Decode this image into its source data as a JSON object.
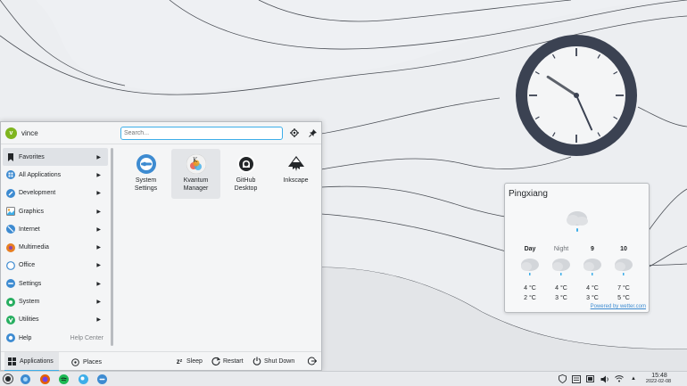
{
  "colors": {
    "accent": "#3daee9",
    "clock_face": "#3b4252",
    "avatar": "#7fb51f"
  },
  "launcher": {
    "user": {
      "initial": "v",
      "name": "vince"
    },
    "search_placeholder": "Search...",
    "categories": [
      {
        "label": "Favorites",
        "icon": "bookmark-icon",
        "extra": ""
      },
      {
        "label": "All Applications",
        "icon": "grid-icon",
        "extra": ""
      },
      {
        "label": "Development",
        "icon": "development-icon",
        "extra": ""
      },
      {
        "label": "Graphics",
        "icon": "graphics-icon",
        "extra": ""
      },
      {
        "label": "Internet",
        "icon": "globe-icon",
        "extra": ""
      },
      {
        "label": "Multimedia",
        "icon": "multimedia-icon",
        "extra": ""
      },
      {
        "label": "Office",
        "icon": "office-icon",
        "extra": ""
      },
      {
        "label": "Settings",
        "icon": "settings-icon",
        "extra": ""
      },
      {
        "label": "System",
        "icon": "system-icon",
        "extra": ""
      },
      {
        "label": "Utilities",
        "icon": "utilities-icon",
        "extra": ""
      },
      {
        "label": "Help",
        "icon": "help-icon",
        "extra": "Help Center"
      }
    ],
    "apps": [
      {
        "line1": "System",
        "line2": "Settings",
        "icon": "system-settings-icon"
      },
      {
        "line1": "Kvantum",
        "line2": "Manager",
        "icon": "kvantum-icon"
      },
      {
        "line1": "GitHub",
        "line2": "Desktop",
        "icon": "github-icon"
      },
      {
        "line1": "Inkscape",
        "line2": "",
        "icon": "inkscape-icon"
      }
    ],
    "tabs": {
      "applications": "Applications",
      "places": "Places"
    },
    "power": {
      "sleep": "Sleep",
      "restart": "Restart",
      "shutdown": "Shut Down"
    }
  },
  "weather": {
    "city": "Pingxiang",
    "credit": "Powered by wetter.com",
    "forecast": [
      {
        "label": "Day",
        "high": "4 °C",
        "low": "2 °C"
      },
      {
        "label": "Night",
        "high": "4 °C",
        "low": "3 °C"
      },
      {
        "label": "9",
        "high": "4 °C",
        "low": "3 °C"
      },
      {
        "label": "10",
        "high": "7 °C",
        "low": "5 °C"
      }
    ]
  },
  "clock": {
    "hour": 4,
    "minute": 48
  },
  "taskbar": {
    "time": "15:48",
    "date": "2022-02-08"
  }
}
